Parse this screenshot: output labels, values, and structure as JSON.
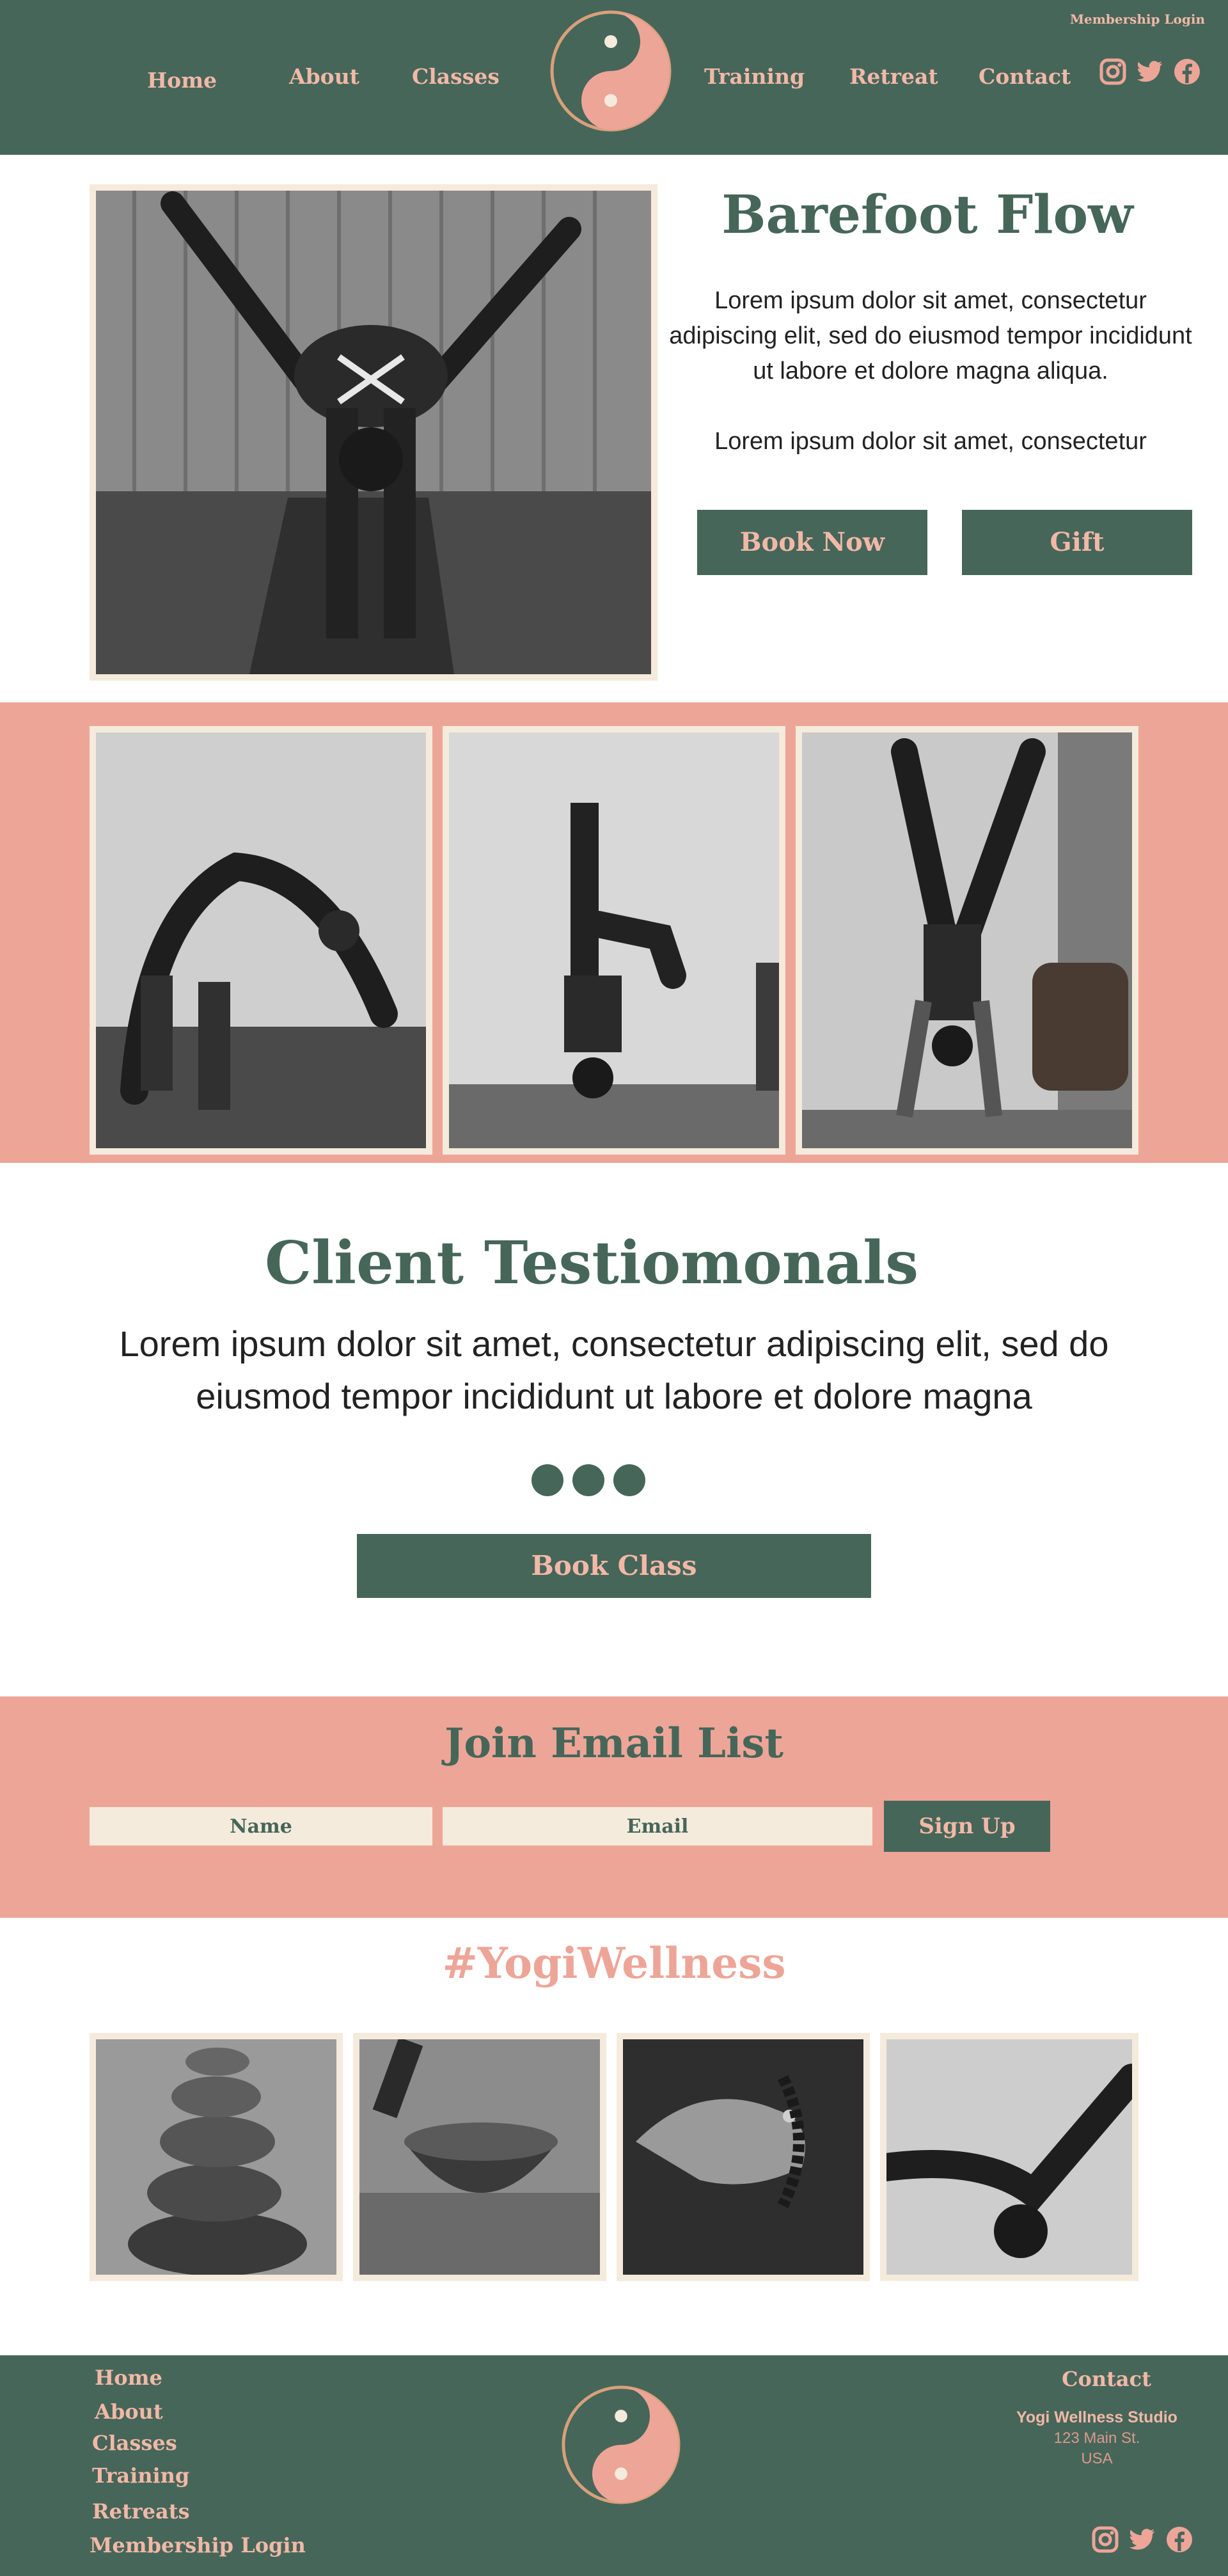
{
  "header": {
    "membership_login": "Membership Login",
    "nav": [
      "Home",
      "About",
      "Classes",
      "Training",
      "Retreat",
      "Contact"
    ],
    "logo_icon": "yin-yang-icon",
    "socials": [
      "instagram-icon",
      "twitter-icon",
      "facebook-icon"
    ]
  },
  "hero": {
    "title": "Barefoot Flow",
    "paragraph1": "Lorem ipsum dolor sit amet, consectetur adipiscing elit, sed do eiusmod tempor incididunt ut labore et dolore magna aliqua.",
    "paragraph2": "Lorem ipsum dolor sit amet, consectetur",
    "book_now": "Book Now",
    "gift": "Gift"
  },
  "testimonials": {
    "title": "Client Testiomonals",
    "text": "Lorem ipsum dolor sit amet, consectetur adipiscing elit, sed do eiusmod tempor incididunt ut labore et dolore magna",
    "book_class": "Book Class"
  },
  "email_list": {
    "title": "Join Email List",
    "name_placeholder": "Name",
    "email_placeholder": "Email",
    "sign_up": "Sign Up"
  },
  "hashtag": "#YogiWellness",
  "footer": {
    "links": [
      "Home",
      "About",
      "Classes",
      "Training",
      "Retreats",
      "Membership Login"
    ],
    "contact_title": "Contact",
    "studio_name": "Yogi Wellness Studio",
    "address_line": "123 Main St.",
    "country": "USA"
  },
  "colors": {
    "green": "#46665a",
    "salmon": "#eda597",
    "cream": "#f5ebdc",
    "pink_text": "#f2b8a6"
  }
}
